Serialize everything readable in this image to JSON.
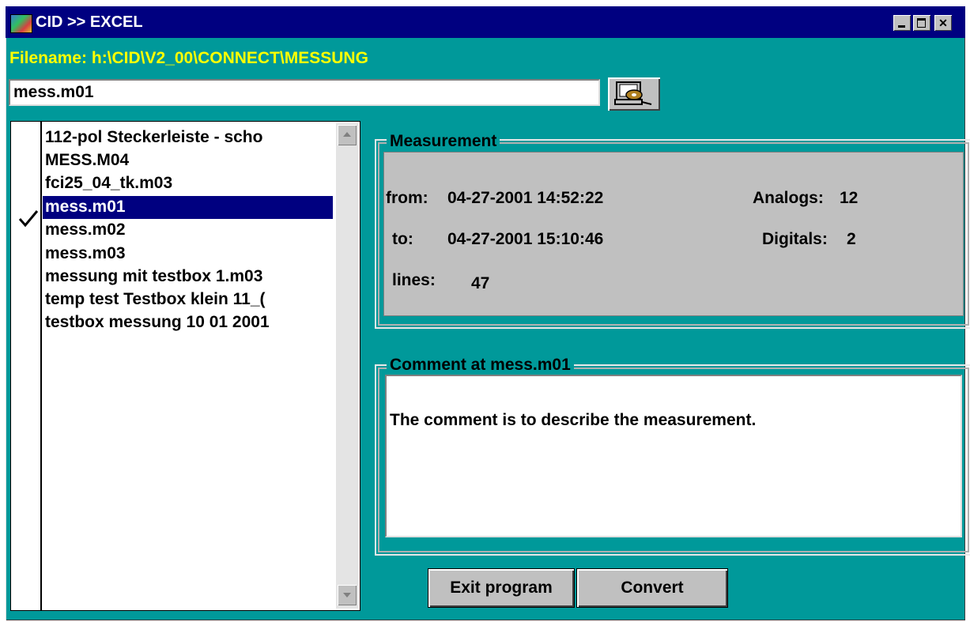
{
  "window": {
    "title": "CID >> EXCEL"
  },
  "header": {
    "filename_label": "Filename: h:\\CID\\V2_00\\CONNECT\\MESSUNG"
  },
  "file_input": {
    "value": "mess.m01"
  },
  "file_list": {
    "items": [
      {
        "label": "112-pol Steckerleiste - scho"
      },
      {
        "label": "MESS.M04"
      },
      {
        "label": "fci25_04_tk.m03"
      },
      {
        "label": "mess.m01"
      },
      {
        "label": "mess.m02"
      },
      {
        "label": "mess.m03"
      },
      {
        "label": "messung mit testbox 1.m03"
      },
      {
        "label": "temp test Testbox klein 11_("
      },
      {
        "label": "testbox messung 10 01 2001"
      }
    ],
    "selected_index": 3
  },
  "measurement": {
    "group_label": "Measurement",
    "from_label": "from:",
    "from_value": "04-27-2001  14:52:22",
    "to_label": "to:",
    "to_value": "04-27-2001  15:10:46",
    "lines_label": "lines:",
    "lines_value": "47",
    "analogs_label": "Analogs:",
    "analogs_value": "12",
    "digitals_label": "Digitals:",
    "digitals_value": "2"
  },
  "comment": {
    "group_label": "Comment at mess.m01",
    "text": "The comment is to describe the measurement."
  },
  "buttons": {
    "exit_label": "Exit program",
    "convert_label": "Convert"
  },
  "colors": {
    "window_bg": "#00999a",
    "titlebar_bg": "#000080",
    "filename_text": "#ffff00",
    "selection_bg": "#000080"
  },
  "icons": {
    "app": "app-icon",
    "browse": "computer-disk-icon",
    "check": "check-icon"
  }
}
